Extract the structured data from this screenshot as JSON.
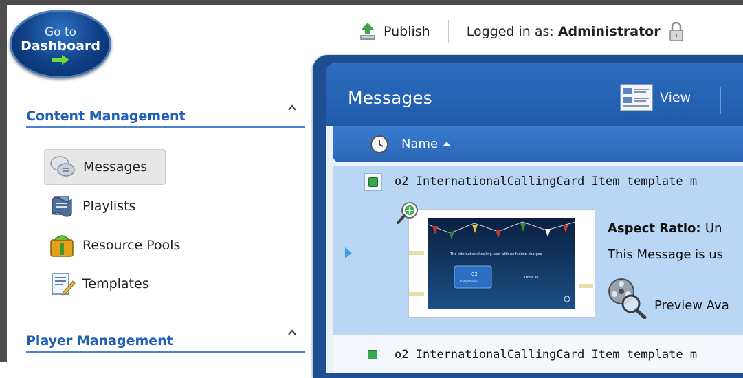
{
  "dashboard": {
    "line1": "Go to",
    "line2": "Dashboard"
  },
  "toolbar": {
    "publish_label": "Publish",
    "logged_in_label": "Logged in as:",
    "logged_in_user": "Administrator"
  },
  "sidebar": {
    "content_section": {
      "title": "Content Management",
      "items": [
        {
          "label": "Messages",
          "icon": "messages-icon",
          "active": true
        },
        {
          "label": "Playlists",
          "icon": "playlists-icon",
          "active": false
        },
        {
          "label": "Resource Pools",
          "icon": "resource-pools-icon",
          "active": false
        },
        {
          "label": "Templates",
          "icon": "templates-icon",
          "active": false
        }
      ]
    },
    "player_section": {
      "title": "Player Management"
    }
  },
  "panel": {
    "title": "Messages",
    "view_label": "View",
    "columns": {
      "name": "Name"
    },
    "rows": [
      {
        "name": "o2 InternationalCallingCard Item template m",
        "aspect_label": "Aspect Ratio:",
        "aspect_value": "Un",
        "usage_text": "This Message is us",
        "preview_text": "Preview Ava"
      },
      {
        "name": "o2 InternationalCallingCard Item template m"
      }
    ]
  },
  "thumbnail": {
    "headline": "The international calling card with no hidden charges",
    "card_brand": "O2",
    "card_text": "International",
    "right_text": "Ohne Ta..."
  },
  "colors": {
    "accent_blue": "#1f5fb8",
    "panel_blue": "#1e5aa8",
    "selected_row": "#b9d6f4"
  }
}
